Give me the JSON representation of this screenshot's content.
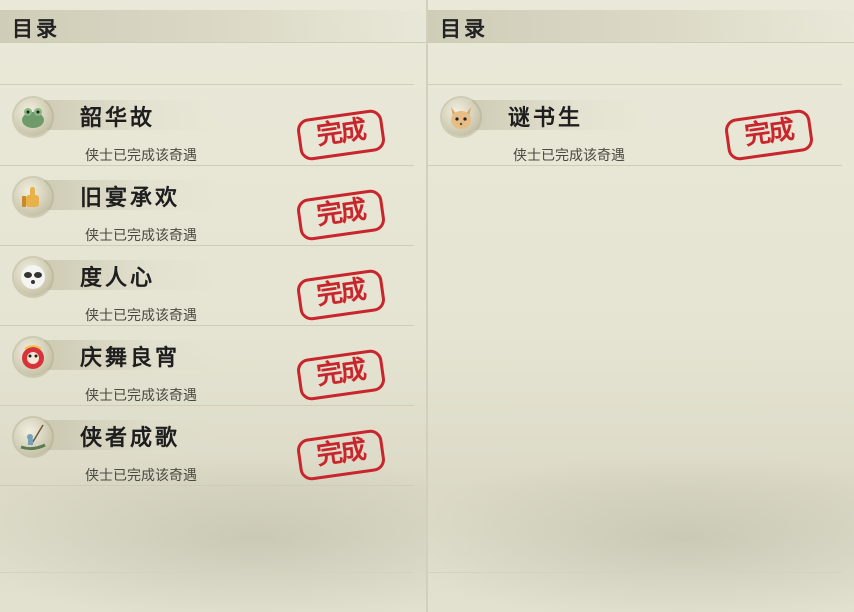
{
  "pages": [
    {
      "header_title": "目录",
      "entries": [
        {
          "name": "韶华故",
          "status": "侠士已完成该奇遇",
          "stamp": "完成",
          "icon": "jade-frog-icon"
        },
        {
          "name": "旧宴承欢",
          "status": "侠士已完成该奇遇",
          "stamp": "完成",
          "icon": "thumbs-up-icon"
        },
        {
          "name": "度人心",
          "status": "侠士已完成该奇遇",
          "stamp": "完成",
          "icon": "panda-mask-icon"
        },
        {
          "name": "庆舞良宵",
          "status": "侠士已完成该奇遇",
          "stamp": "完成",
          "icon": "lion-dance-icon"
        },
        {
          "name": "侠者成歌",
          "status": "侠士已完成该奇遇",
          "stamp": "完成",
          "icon": "fishing-hermit-icon"
        }
      ]
    },
    {
      "header_title": "目录",
      "entries": [
        {
          "name": "谜书生",
          "status": "侠士已完成该奇遇",
          "stamp": "完成",
          "icon": "fox-icon"
        }
      ]
    }
  ],
  "colors": {
    "stamp": "#c8262c",
    "paper": "#e6e4d3",
    "text": "#1e1e1e"
  }
}
